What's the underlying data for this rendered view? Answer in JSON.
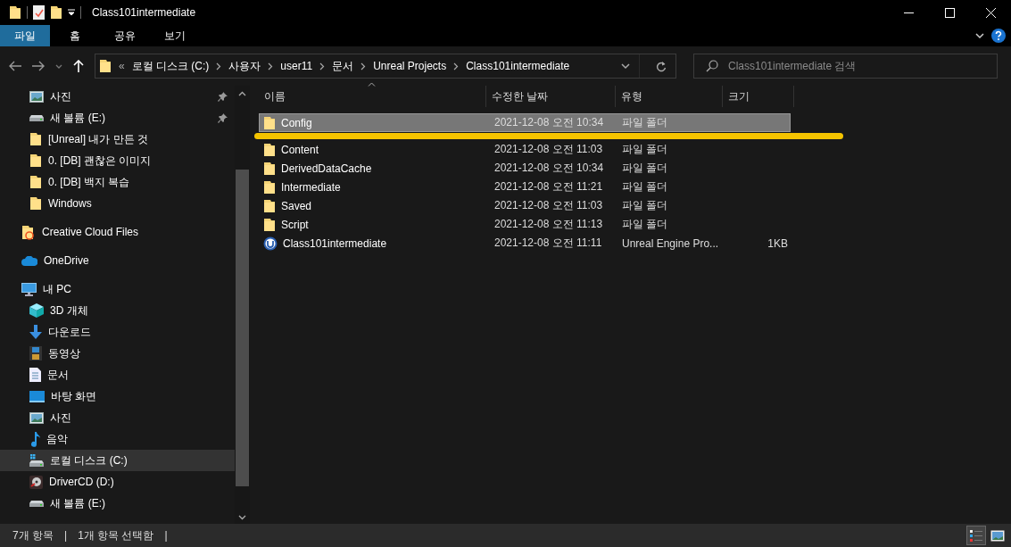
{
  "window": {
    "title": "Class101intermediate"
  },
  "ribbon_tabs": [
    {
      "label": "파일",
      "selected": true
    },
    {
      "label": "홈",
      "selected": false
    },
    {
      "label": "공유",
      "selected": false
    },
    {
      "label": "보기",
      "selected": false
    }
  ],
  "address_bar": {
    "overflow": "«",
    "segments": [
      "로컬 디스크 (C:)",
      "사용자",
      "user11",
      "문서",
      "Unreal Projects",
      "Class101intermediate"
    ]
  },
  "search": {
    "placeholder": "Class101intermediate 검색"
  },
  "sidebar": {
    "quick_access": [
      {
        "label": "사진",
        "kind": "pictures",
        "pinned": true,
        "selected": false
      },
      {
        "label": "새 볼륨 (E:)",
        "kind": "drive",
        "pinned": true,
        "selected": false
      },
      {
        "label": "[Unreal] 내가 만든 것",
        "kind": "folder",
        "pinned": false,
        "selected": false
      },
      {
        "label": "0. [DB] 괜찮은 이미지",
        "kind": "folder",
        "pinned": false,
        "selected": false
      },
      {
        "label": "0. [DB] 백지 복습",
        "kind": "folder",
        "pinned": false,
        "selected": false
      },
      {
        "label": "Windows",
        "kind": "folder",
        "pinned": false,
        "selected": false
      }
    ],
    "tree": [
      {
        "label": "Creative Cloud Files",
        "kind": "cloudfolder",
        "selected": false
      },
      {
        "label": "OneDrive",
        "kind": "cloud",
        "selected": false
      },
      {
        "label": "내 PC",
        "kind": "computer",
        "selected": false,
        "children": [
          {
            "label": "3D 개체",
            "kind": "cube",
            "selected": false
          },
          {
            "label": "다운로드",
            "kind": "downloads",
            "selected": false
          },
          {
            "label": "동영상",
            "kind": "videos",
            "selected": false
          },
          {
            "label": "문서",
            "kind": "documents",
            "selected": false
          },
          {
            "label": "바탕 화면",
            "kind": "desktop",
            "selected": false
          },
          {
            "label": "사진",
            "kind": "pictures",
            "selected": false
          },
          {
            "label": "음악",
            "kind": "music",
            "selected": false
          },
          {
            "label": "로컬 디스크 (C:)",
            "kind": "systemdrive",
            "selected": true
          },
          {
            "label": "DriverCD (D:)",
            "kind": "disc",
            "selected": false
          },
          {
            "label": "새 볼륨 (E:)",
            "kind": "drive",
            "selected": false
          }
        ]
      }
    ]
  },
  "table": {
    "columns": [
      "이름",
      "수정한 날짜",
      "유형",
      "크기"
    ],
    "rows": [
      {
        "name": "Config",
        "kind": "folder",
        "date": "2021-12-08 오전 10:34",
        "type": "파일 폴더",
        "selected": true
      },
      {
        "name": "Content",
        "kind": "folder",
        "date": "2021-12-08 오전 11:03",
        "type": "파일 폴더",
        "selected": false
      },
      {
        "name": "DerivedDataCache",
        "kind": "folder",
        "date": "2021-12-08 오전 10:34",
        "type": "파일 폴더",
        "selected": false
      },
      {
        "name": "Intermediate",
        "kind": "folder",
        "date": "2021-12-08 오전 11:21",
        "type": "파일 폴더",
        "selected": false
      },
      {
        "name": "Saved",
        "kind": "folder",
        "date": "2021-12-08 오전 11:03",
        "type": "파일 폴더",
        "selected": false
      },
      {
        "name": "Script",
        "kind": "folder",
        "date": "2021-12-08 오전 11:13",
        "type": "파일 폴더",
        "selected": false
      },
      {
        "name": "Class101intermediate",
        "kind": "project",
        "date": "2021-12-08 오전 11:11",
        "type": "Unreal Engine Pro...",
        "size": "1KB",
        "selected": false
      }
    ]
  },
  "annotations": [
    {
      "kind": "marker-line"
    }
  ],
  "status_bar": {
    "texts": [
      "7개 항목",
      "|",
      "1개 항목 선택함",
      "|"
    ],
    "view_buttons": [
      {
        "kind": "details",
        "selected": true
      },
      {
        "kind": "large-icons",
        "selected": false
      }
    ]
  }
}
